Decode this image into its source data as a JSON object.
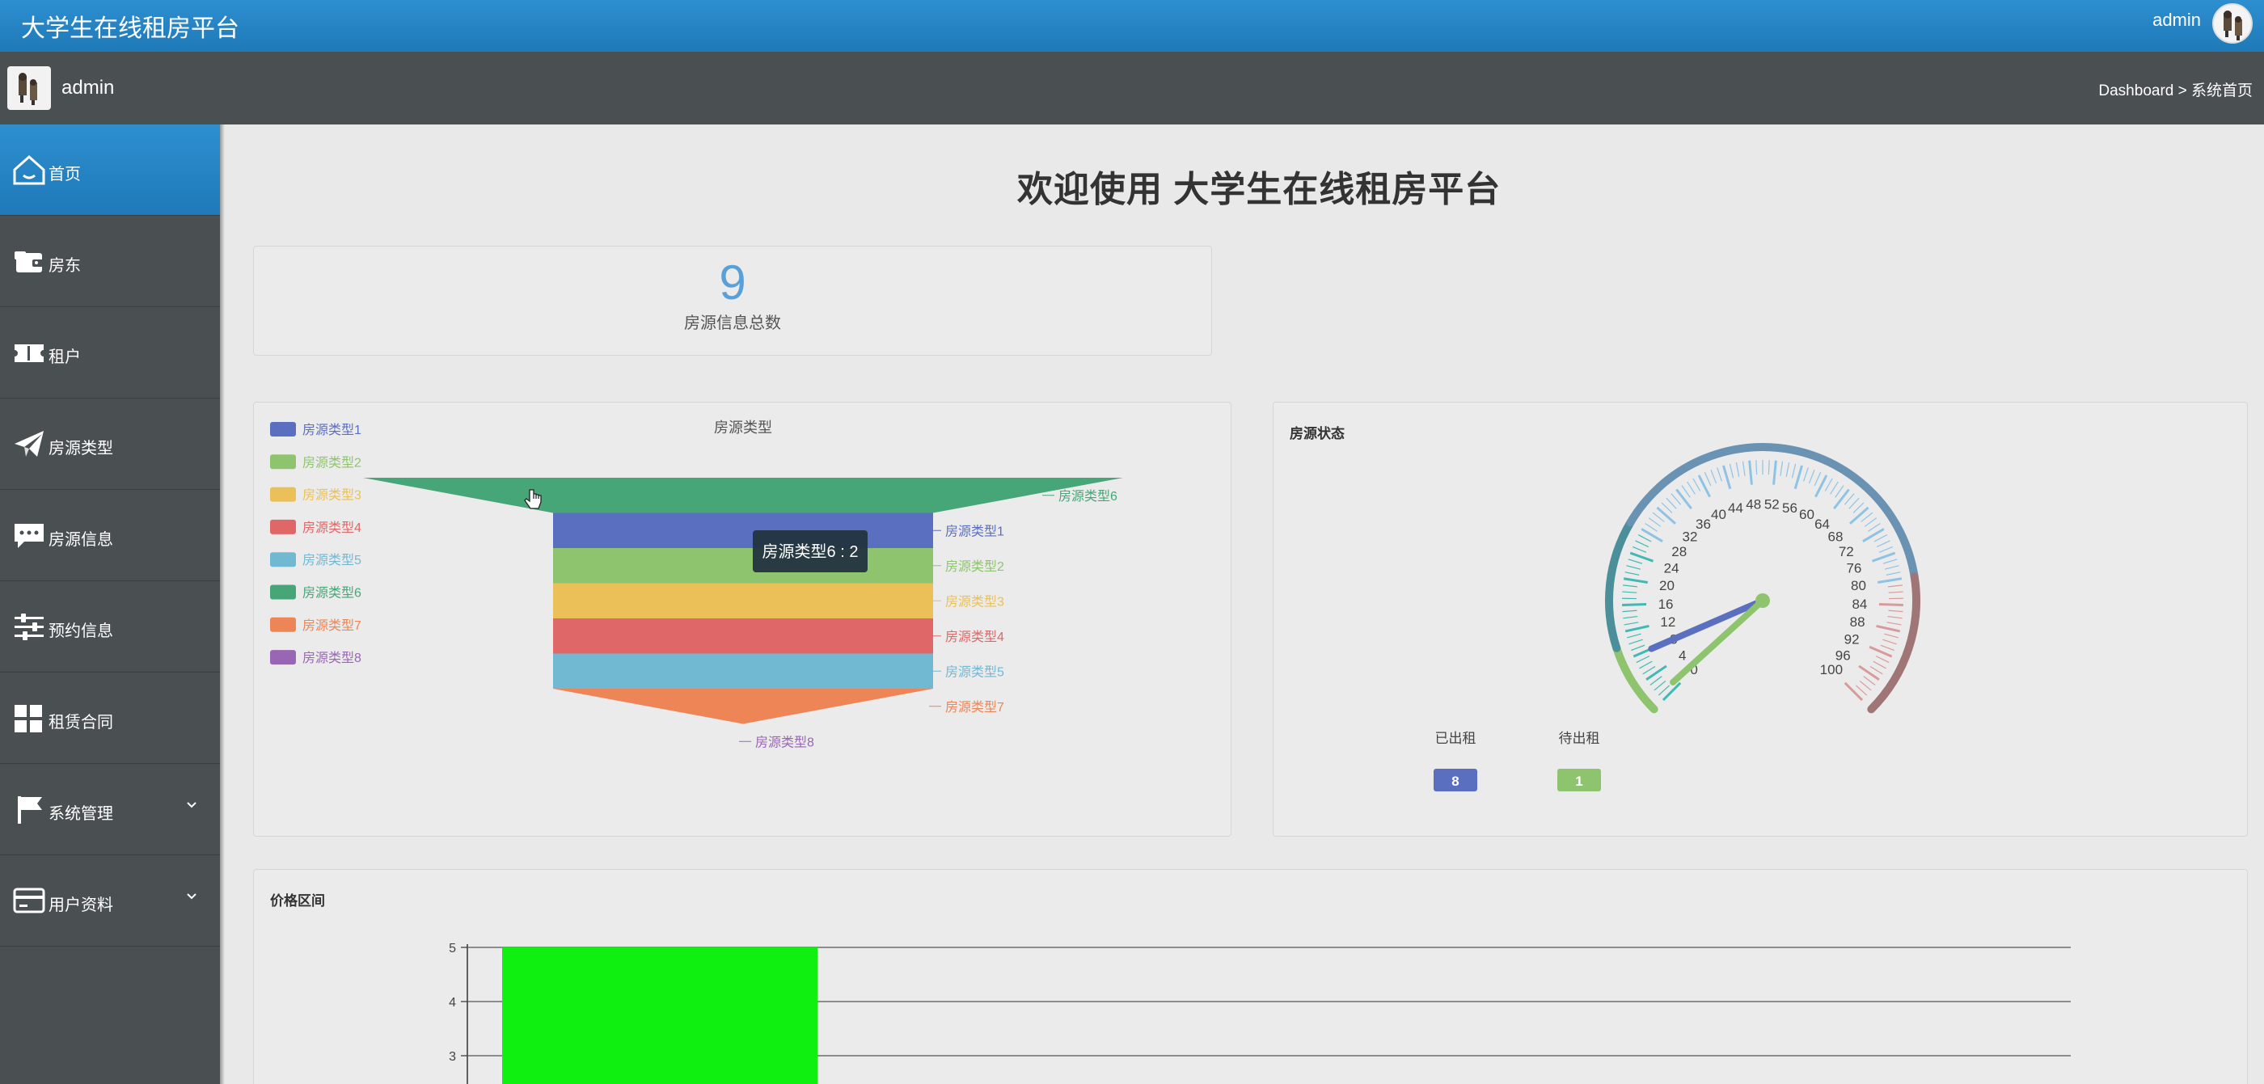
{
  "app": {
    "title": "大学生在线租房平台",
    "user": "admin"
  },
  "subbar": {
    "username": "admin",
    "breadcrumb": "Dashboard > 系统首页"
  },
  "sidebar": {
    "items": [
      {
        "label": "首页",
        "icon": "home-icon",
        "active": true
      },
      {
        "label": "房东",
        "icon": "wallet-icon"
      },
      {
        "label": "租户",
        "icon": "ticket-icon"
      },
      {
        "label": "房源类型",
        "icon": "paper-plane-icon"
      },
      {
        "label": "房源信息",
        "icon": "chat-icon"
      },
      {
        "label": "预约信息",
        "icon": "sliders-icon"
      },
      {
        "label": "租赁合同",
        "icon": "grid-icon"
      },
      {
        "label": "系统管理",
        "icon": "flag-icon",
        "expandable": true
      },
      {
        "label": "用户资料",
        "icon": "card-icon",
        "expandable": true
      }
    ]
  },
  "welcome": "欢迎使用 大学生在线租房平台",
  "stat": {
    "value": "9",
    "caption": "房源信息总数"
  },
  "funnel": {
    "title": "房源类型",
    "tooltip": "房源类型6 : 2"
  },
  "gauge": {
    "title": "房源状态",
    "tick_labels": [
      "0",
      "4",
      "8",
      "12",
      "16",
      "20",
      "24",
      "28",
      "32",
      "36",
      "40",
      "44",
      "48",
      "52",
      "56",
      "60",
      "64",
      "68",
      "72",
      "76",
      "80",
      "84",
      "88",
      "92",
      "96",
      "100"
    ]
  },
  "price": {
    "title": "价格区间"
  },
  "colors": {
    "accent": "#1f79b8",
    "sidebar": "#4a4f51",
    "bar": "#10f010"
  },
  "chart_data": [
    {
      "type": "funnel",
      "title": "房源类型",
      "legend_position": "left",
      "categories": [
        "房源类型1",
        "房源类型2",
        "房源类型3",
        "房源类型4",
        "房源类型5",
        "房源类型6",
        "房源类型7",
        "房源类型8"
      ],
      "colors": [
        "#5b6fc0",
        "#8fc46e",
        "#ebc059",
        "#e06767",
        "#71b8d3",
        "#46a677",
        "#ed8556",
        "#9966b5"
      ],
      "values": [
        1,
        1,
        1,
        1,
        1,
        2,
        1,
        0
      ]
    },
    {
      "type": "gauge",
      "title": "房源状态",
      "range": [
        0,
        100
      ],
      "series": [
        {
          "name": "已出租",
          "value": 8,
          "color": "#5b6fc0"
        },
        {
          "name": "待出租",
          "value": 1,
          "color": "#8fc46e"
        }
      ]
    },
    {
      "type": "bar",
      "title": "价格区间",
      "values": [
        5
      ],
      "ylim": [
        0,
        5
      ],
      "y_ticks": [
        3,
        4,
        5
      ],
      "color": "#10f010"
    }
  ]
}
